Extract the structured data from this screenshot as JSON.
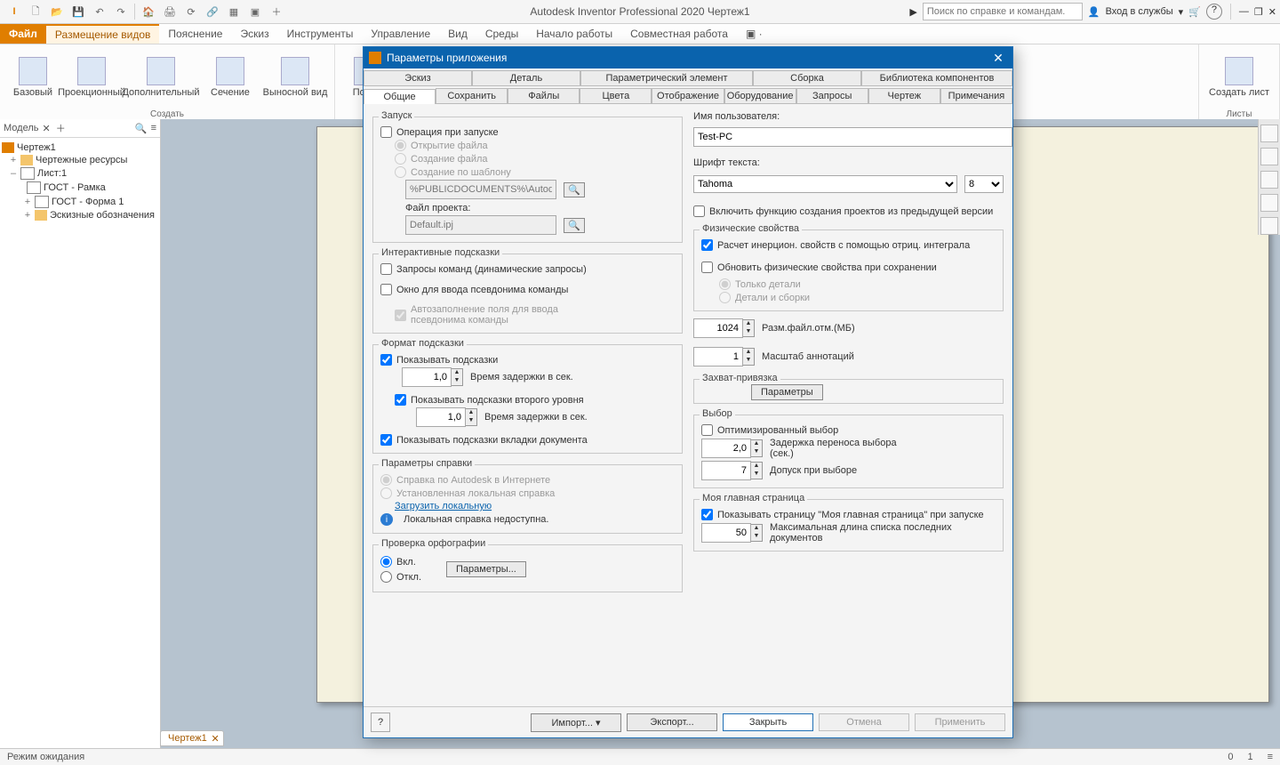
{
  "app": {
    "title": "Autodesk Inventor Professional 2020   Чертеж1",
    "search_ph": "Поиск по справке и командам.",
    "signin": "Вход в службы"
  },
  "ribbonTabs": {
    "file": "Файл",
    "active": "Размещение видов",
    "others": [
      "Пояснение",
      "Эскиз",
      "Инструменты",
      "Управление",
      "Вид",
      "Среды",
      "Начало работы",
      "Совместная работа"
    ]
  },
  "ribbon": {
    "g1": {
      "label": "Создать",
      "btns": [
        "Базовый",
        "Проекционный",
        "Дополнительный",
        "Сечение",
        "Выносной вид"
      ]
    },
    "g2": {
      "label": "",
      "btns": [
        "Позиц."
      ]
    },
    "g3": {
      "label": "Листы",
      "btns": [
        "Создать лист"
      ]
    }
  },
  "model": {
    "title": "Модель",
    "root": "Чертеж1",
    "res": "Чертежные ресурсы",
    "sheet": "Лист:1",
    "items": [
      "ГОСТ - Рамка",
      "ГОСТ - Форма 1",
      "Эскизные обозначения"
    ]
  },
  "docTab": "Чертеж1",
  "status": {
    "text": "Режим ожидания",
    "n0": "0",
    "n1": "1"
  },
  "dlg": {
    "title": "Параметры приложения",
    "tabs1": [
      "Эскиз",
      "Деталь",
      "Параметрический элемент",
      "Сборка",
      "Библиотека компонентов"
    ],
    "tabs2": [
      "Общие",
      "Сохранить",
      "Файлы",
      "Цвета",
      "Отображение",
      "Оборудование",
      "Запросы",
      "Чертеж",
      "Примечания"
    ],
    "activeTab": "Общие",
    "startup": {
      "label": "Запуск",
      "op": "Операция при запуске",
      "open": "Открытие файла",
      "create": "Создание файла",
      "tmpl": "Создание по шаблону",
      "tmplPath": "%PUBLICDOCUMENTS%\\Autodesk\\Inv",
      "projLabel": "Файл проекта:",
      "projVal": "Default.ipj"
    },
    "hints": {
      "label": "Интерактивные подсказки",
      "cmd": "Запросы команд (динамические запросы)",
      "alias": "Окно для ввода псевдонима команды",
      "auto": "Автозаполнение поля для ввода псевдонима команды"
    },
    "fmt": {
      "label": "Формат подсказки",
      "show1": "Показывать подсказки",
      "d1": "1,0",
      "dl": "Время задержки в сек.",
      "show2": "Показывать подсказки второго уровня",
      "d2": "1,0",
      "tabHints": "Показывать подсказки вкладки документа"
    },
    "help": {
      "label": "Параметры справки",
      "online": "Справка по Autodesk в Интернете",
      "local": "Установленная локальная справка",
      "link": "Загрузить локальную",
      "info": "Локальная справка недоступна."
    },
    "spell": {
      "label": "Проверка орфографии",
      "on": "Вкл.",
      "off": "Откл.",
      "btn": "Параметры..."
    },
    "user": {
      "label": "Имя пользователя:",
      "val": "Test-PC"
    },
    "font": {
      "label": "Шрифт текста:",
      "name": "Tahoma",
      "size": "8"
    },
    "compat": "Включить функцию создания проектов из предыдущей версии",
    "phys": {
      "label": "Физические свойства",
      "neg": "Расчет инерцион. свойств с помощью отриц. интеграла",
      "upd": "Обновить физические свойства при сохранении",
      "onlyParts": "Только детали",
      "partsAsm": "Детали и сборки"
    },
    "undo": {
      "val": "1024",
      "label": "Разм.файл.отм.(МБ)"
    },
    "annoScale": {
      "val": "1",
      "label": "Масштаб аннотаций"
    },
    "snap": {
      "label": "Захват-привязка",
      "btn": "Параметры"
    },
    "sel": {
      "label": "Выбор",
      "opt": "Оптимизированный выбор",
      "delayVal": "2,0",
      "delayLabel": "Задержка переноса выбора (сек.)",
      "tolVal": "7",
      "tolLabel": "Допуск при выборе"
    },
    "home": {
      "label": "Моя главная страница",
      "show": "Показывать страницу \"Моя главная страница\" при запуске",
      "listVal": "50",
      "listLabel": "Максимальная длина списка последних документов"
    },
    "footer": {
      "import": "Импорт...",
      "export": "Экспорт...",
      "close": "Закрыть",
      "cancel": "Отмена",
      "apply": "Применить"
    }
  }
}
